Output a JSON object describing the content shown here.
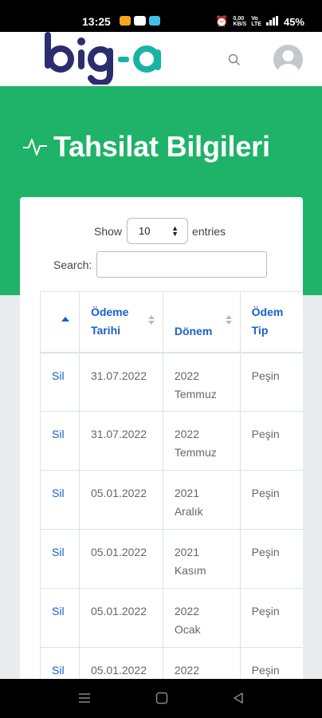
{
  "status_bar": {
    "time": "13:25",
    "net_speed_top": "0,00",
    "net_speed_bottom": "KB/S",
    "network_top": "Vo",
    "network_bottom": "LTE",
    "battery": "45%"
  },
  "header": {
    "logo_text": "big-a",
    "search_icon": "search-icon",
    "avatar_icon": "avatar-icon"
  },
  "hero": {
    "title": "Tahsilat Bilgileri",
    "icon": "activity-pulse-icon"
  },
  "table_controls": {
    "show_label": "Show",
    "entries_value": "10",
    "entries_label": "entries",
    "search_label": "Search:",
    "search_value": ""
  },
  "table": {
    "headers": [
      "",
      "Ödeme Tarihi",
      "Dönem",
      "Ödem Tip"
    ],
    "header_lines": {
      "date": [
        "Ödeme",
        "Tarihi"
      ],
      "period": [
        "Dönem"
      ],
      "type": [
        "Ödem",
        "Tip"
      ]
    },
    "rows": [
      {
        "action": "Sil",
        "date": "31.07.2022",
        "period_year": "2022",
        "period_month": "Temmuz",
        "type": "Peşin"
      },
      {
        "action": "Sil",
        "date": "31.07.2022",
        "period_year": "2022",
        "period_month": "Temmuz",
        "type": "Peşin"
      },
      {
        "action": "Sil",
        "date": "05.01.2022",
        "period_year": "2021",
        "period_month": "Aralık",
        "type": "Peşin"
      },
      {
        "action": "Sil",
        "date": "05.01.2022",
        "period_year": "2021",
        "period_month": "Kasım",
        "type": "Peşin"
      },
      {
        "action": "Sil",
        "date": "05.01.2022",
        "period_year": "2022",
        "period_month": "Ocak",
        "type": "Peşin"
      },
      {
        "action": "Sil",
        "date": "05.01.2022",
        "period_year": "2022",
        "period_month": "",
        "type": "Peşin"
      }
    ]
  },
  "colors": {
    "brand_green": "#1fb369",
    "link_blue": "#1a5fcc",
    "logo_navy": "#2b2d6e",
    "logo_teal": "#18b3a4"
  }
}
